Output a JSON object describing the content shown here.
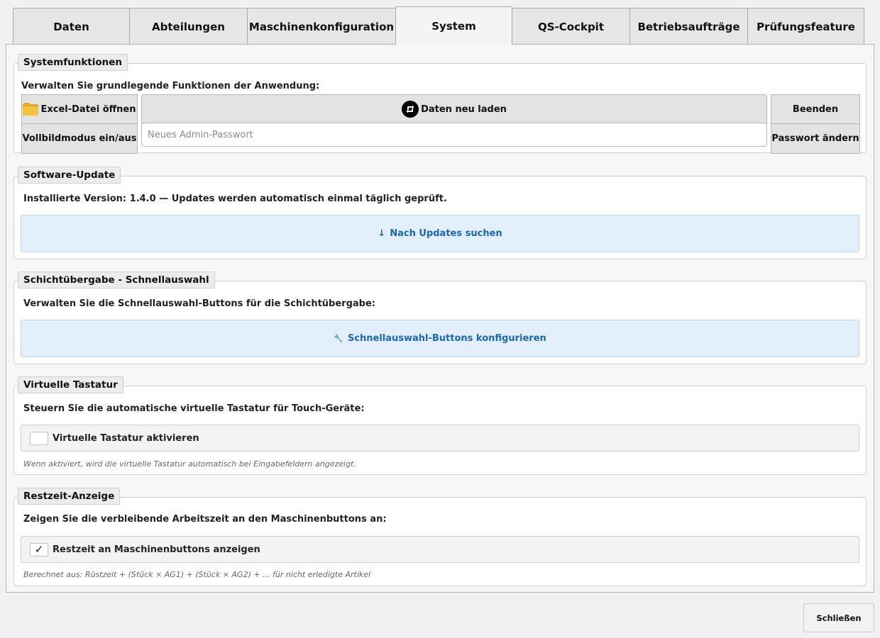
{
  "tabs": [
    {
      "label": "Daten",
      "active": false
    },
    {
      "label": "Abteilungen",
      "active": false
    },
    {
      "label": "Maschinenkonfiguration",
      "active": false
    },
    {
      "label": "System",
      "active": true
    },
    {
      "label": "QS-Cockpit",
      "active": false
    },
    {
      "label": "Betriebsaufträge",
      "active": false
    },
    {
      "label": "Prüfungsfeature",
      "active": false
    }
  ],
  "system_functions": {
    "title": "Systemfunktionen",
    "description": "Verwalten Sie grundlegende Funktionen der Anwendung:",
    "open_excel_label": "Excel-Datei öffnen",
    "open_excel_icon": "folder-icon",
    "reload_label": "Daten neu laden",
    "reload_icon": "reload-icon",
    "quit_label": "Beenden",
    "fullscreen_label": "Vollbildmodus ein/aus",
    "password_placeholder": "Neues Admin-Passwort",
    "password_value": "",
    "change_password_label": "Passwort ändern"
  },
  "software_update": {
    "title": "Software-Update",
    "description": "Installierte Version: 1.4.0 — Updates werden automatisch einmal täglich geprüft.",
    "check_button_label": "Nach Updates suchen",
    "check_button_icon": "↓"
  },
  "shift_handover": {
    "title": "Schichtübergabe - Schnellauswahl",
    "description": "Verwalten Sie die Schnellauswahl-Buttons für die Schichtübergabe:",
    "configure_button_label": "Schnellauswahl-Buttons konfigurieren",
    "configure_button_icon": "🔧"
  },
  "virtual_keyboard": {
    "title": "Virtuelle Tastatur",
    "description": "Steuern Sie die automatische virtuelle Tastatur für Touch-Geräte:",
    "checkbox_label": "Virtuelle Tastatur aktivieren",
    "checked": false,
    "hint": "Wenn aktiviert, wird die virtuelle Tastatur automatisch bei Eingabefeldern angezeigt."
  },
  "remaining_time": {
    "title": "Restzeit-Anzeige",
    "description": "Zeigen Sie die verbleibende Arbeitszeit an den Maschinenbuttons an:",
    "checkbox_label": "Restzeit an Maschinenbuttons anzeigen",
    "checked": true,
    "check_glyph": "✓",
    "hint": "Berechnet aus: Rüstzeit + (Stück × AG1) + (Stück × AG2) + ... für nicht erledigte Artikel"
  },
  "footer": {
    "close_label": "Schließen"
  },
  "colors": {
    "accent_text": "#1a66b8",
    "accent_bg": "#e3f0fc"
  }
}
